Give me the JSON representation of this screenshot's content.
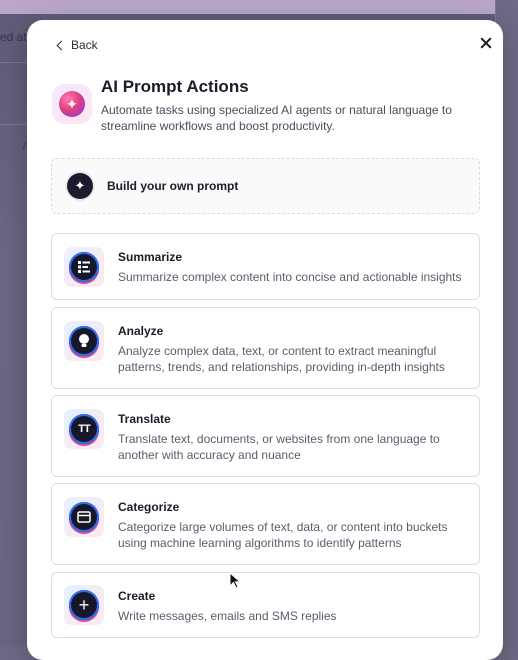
{
  "background": {
    "partial_text": "ed at"
  },
  "modal": {
    "back_label": "Back",
    "title": "AI Prompt Actions",
    "subtitle": "Automate tasks using specialized AI agents or natural language to streamline workflows and boost productivity.",
    "header_icon": "sparkle-orb-icon",
    "build_own": {
      "label": "Build your own prompt",
      "icon": "sparkle-icon"
    },
    "actions": [
      {
        "title": "Summarize",
        "description": "Summarize complex content into concise and actionable insights",
        "icon": "list-icon"
      },
      {
        "title": "Analyze",
        "description": "Analyze complex data, text, or content to extract meaningful patterns, trends, and relationships, providing in-depth insights",
        "icon": "lightbulb-icon"
      },
      {
        "title": "Translate",
        "description": "Translate text, documents, or websites from one language to another with accuracy and nuance",
        "icon": "text-tt-icon"
      },
      {
        "title": "Categorize",
        "description": "Categorize large volumes of text, data, or content into buckets using machine learning algorithms to identify patterns",
        "icon": "card-icon"
      },
      {
        "title": "Create",
        "description": "Write messages, emails and SMS replies",
        "icon": "plus-icon"
      }
    ]
  },
  "colors": {
    "accent_blue": "#2f6df6",
    "accent_pink": "#e44a85",
    "dark": "#16182a"
  }
}
